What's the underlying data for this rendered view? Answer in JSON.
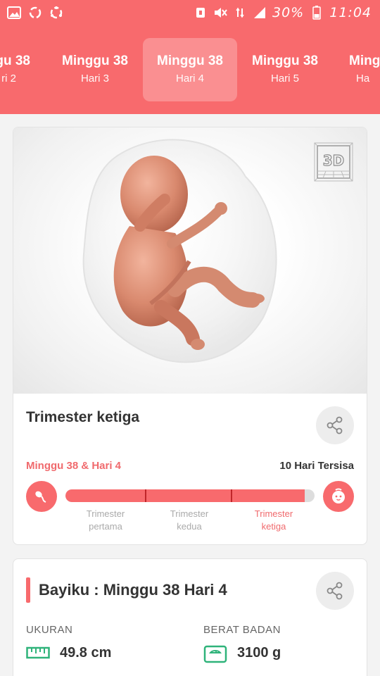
{
  "status_bar": {
    "battery_percent": "30%",
    "time": "11:04",
    "icons": [
      "image-icon",
      "recycle-icon",
      "share-link-icon",
      "vpn-icon",
      "mute-icon",
      "data-signal-icon",
      "signal-icon",
      "battery-icon"
    ]
  },
  "tabs": [
    {
      "week": "ggu 38",
      "day": "ri 2"
    },
    {
      "week": "Minggu 38",
      "day": "Hari 3"
    },
    {
      "week": "Minggu 38",
      "day": "Hari 4",
      "active": true
    },
    {
      "week": "Minggu 38",
      "day": "Hari 5"
    },
    {
      "week": "Ming",
      "day": "Ha"
    }
  ],
  "hero": {
    "badge": "3D"
  },
  "trimester": {
    "title": "Trimester ketiga",
    "current": "Minggu 38 & Hari 4",
    "remaining": "10 Hari Tersisa",
    "progress": 0.96,
    "labels": [
      {
        "line1": "Trimester",
        "line2": "pertama"
      },
      {
        "line1": "Trimester",
        "line2": "kedua"
      },
      {
        "line1": "Trimester",
        "line2": "ketiga"
      }
    ]
  },
  "baby": {
    "title": "Bayiku : Minggu 38 Hari 4",
    "size_label": "UKURAN",
    "size_value": "49.8 cm",
    "weight_label": "BERAT BADAN",
    "weight_value": "3100 g"
  },
  "colors": {
    "primary": "#f86a6d",
    "accent_text": "#f06a6d",
    "icon_green": "#2fb37a"
  }
}
